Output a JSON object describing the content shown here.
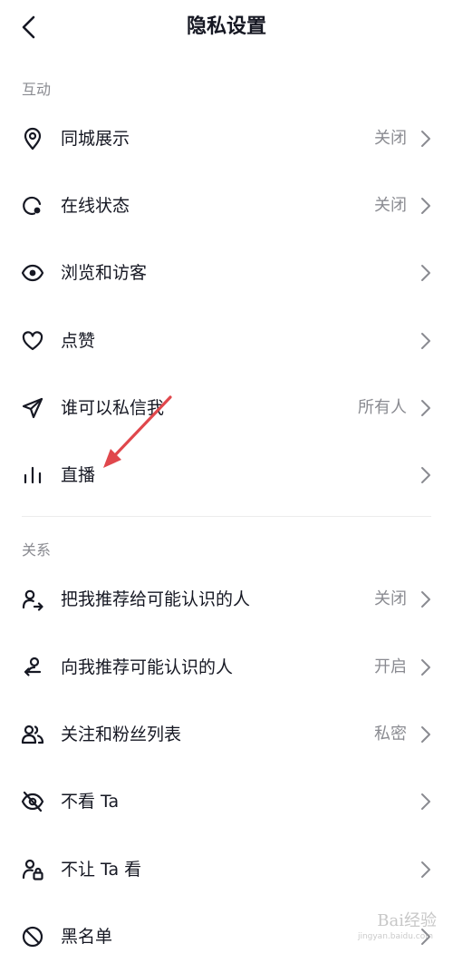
{
  "header": {
    "title": "隐私设置"
  },
  "sections": [
    {
      "title": "互动"
    },
    {
      "title": "关系"
    }
  ],
  "rows": [
    {
      "label": "同城展示",
      "value": "关闭",
      "icon": "location-pin-icon"
    },
    {
      "label": "在线状态",
      "value": "关闭",
      "icon": "online-status-icon"
    },
    {
      "label": "浏览和访客",
      "value": "",
      "icon": "eye-icon"
    },
    {
      "label": "点赞",
      "value": "",
      "icon": "heart-icon"
    },
    {
      "label": "谁可以私信我",
      "value": "所有人",
      "icon": "paper-plane-icon"
    },
    {
      "label": "直播",
      "value": "",
      "icon": "live-bars-icon"
    },
    {
      "label": "把我推荐给可能认识的人",
      "value": "关闭",
      "icon": "user-share-icon"
    },
    {
      "label": "向我推荐可能认识的人",
      "value": "开启",
      "icon": "user-recommend-icon"
    },
    {
      "label": "关注和粉丝列表",
      "value": "私密",
      "icon": "users-icon"
    },
    {
      "label": "不看 Ta",
      "value": "",
      "icon": "eye-off-icon"
    },
    {
      "label": "不让 Ta 看",
      "value": "",
      "icon": "user-lock-icon"
    },
    {
      "label": "黑名单",
      "value": "",
      "icon": "block-icon"
    }
  ],
  "watermark": {
    "text": "Bai经验",
    "sub": "jingyan.baidu.com"
  },
  "colors": {
    "text": "#161823",
    "secondary": "#8a8b91",
    "annotation_arrow": "#e0474c"
  }
}
